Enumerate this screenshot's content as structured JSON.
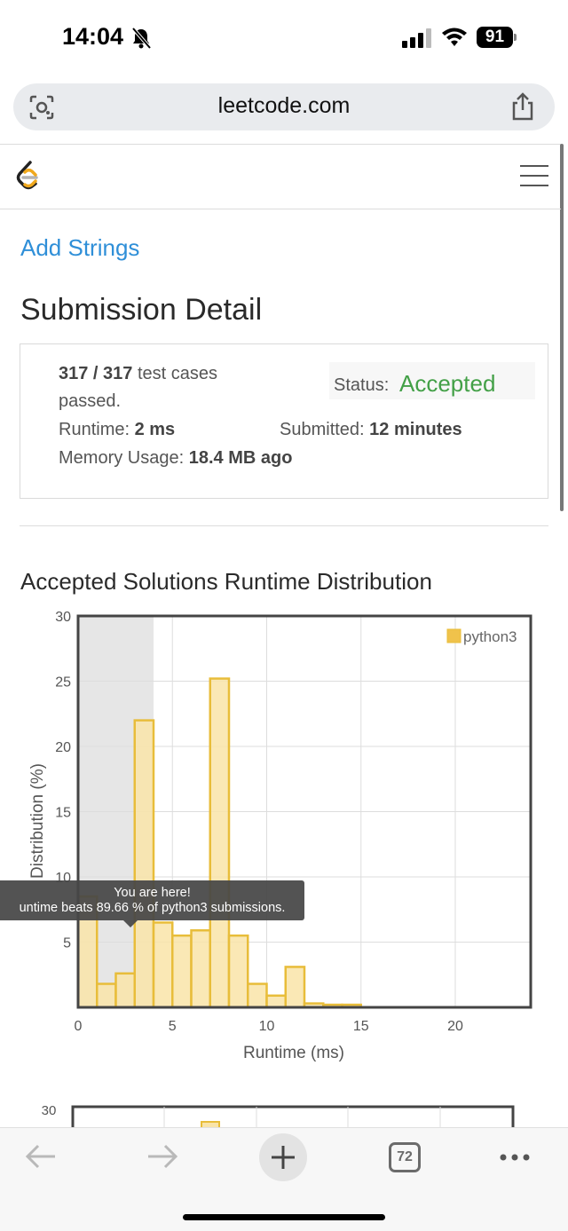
{
  "status_bar": {
    "time": "14:04",
    "battery": "91"
  },
  "browser": {
    "url": "leetcode.com",
    "tab_count": "72"
  },
  "page": {
    "problem_link": "Add Strings",
    "title": "Submission Detail"
  },
  "summary": {
    "passed_count": "317 / 317",
    "passed_text": " test cases",
    "passed_line2": "passed.",
    "status_label": "Status: ",
    "status_value": "Accepted",
    "runtime_label": "Runtime: ",
    "runtime_value": "2 ms",
    "submitted_label": "Submitted: ",
    "submitted_value": "12 minutes",
    "memory_label": "Memory Usage: ",
    "memory_value": "18.4 MB ago"
  },
  "colors": {
    "accent_blue": "#2f8fd8",
    "accepted_green": "#43a047",
    "bar_fill": "#f9e4a8",
    "bar_stroke": "#e8bd3a"
  },
  "tooltip": {
    "line1": "You are here!",
    "line2": "untime beats 89.66 % of python3 submissions."
  },
  "chart_data": {
    "type": "bar",
    "title": "Accepted Solutions Runtime Distribution",
    "xlabel": "Runtime (ms)",
    "ylabel": "Distribution (%)",
    "xlim": [
      0,
      24
    ],
    "ylim": [
      0,
      30
    ],
    "xticks": [
      0,
      5,
      10,
      15,
      20
    ],
    "yticks": [
      5,
      10,
      15,
      20,
      25,
      30
    ],
    "highlight_range": [
      0,
      4
    ],
    "grid": true,
    "legend": {
      "position": "top-right",
      "entries": [
        "python3"
      ]
    },
    "series": [
      {
        "name": "python3",
        "bins": [
          {
            "x": 0,
            "value": 8.5
          },
          {
            "x": 1,
            "value": 1.8
          },
          {
            "x": 2,
            "value": 2.6
          },
          {
            "x": 3,
            "value": 22.0
          },
          {
            "x": 4,
            "value": 6.5
          },
          {
            "x": 5,
            "value": 5.5
          },
          {
            "x": 6,
            "value": 5.9
          },
          {
            "x": 7,
            "value": 25.2
          },
          {
            "x": 8,
            "value": 5.5
          },
          {
            "x": 9,
            "value": 1.8
          },
          {
            "x": 10,
            "value": 0.9
          },
          {
            "x": 11,
            "value": 3.1
          },
          {
            "x": 12,
            "value": 0.3
          },
          {
            "x": 13,
            "value": 0.2
          },
          {
            "x": 14,
            "value": 0.2
          }
        ]
      }
    ]
  },
  "chart2": {
    "ytick_top": "30"
  }
}
